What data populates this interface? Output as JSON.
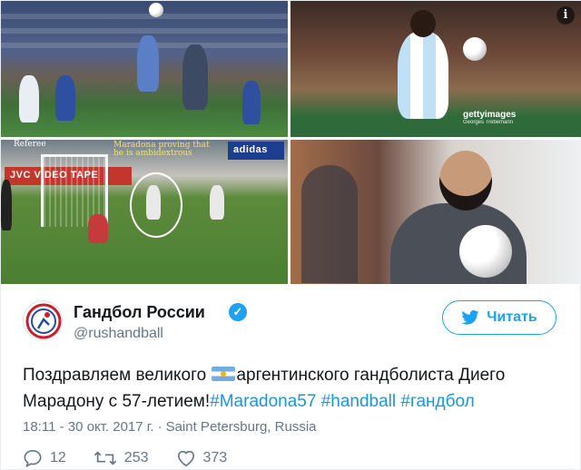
{
  "media": {
    "tile3": {
      "referee_label": "Referee",
      "annotation": "Maradona proving that he is ambidextrous",
      "ad_boards": [
        "JVC VIDEO TAPE",
        "adidas"
      ]
    },
    "tile2": {
      "watermark_brand": "gettyimages",
      "watermark_credit": "Georges Trebemann"
    }
  },
  "tweet": {
    "author_name": "Гандбол России",
    "author_handle": "@rushandball",
    "follow_label": "Читать",
    "text_part1": "Поздравляем великого ",
    "text_part2": "аргентинского гандболиста Диего Марадону с 57-летием!",
    "hashtags": [
      "#Maradona57",
      "#handball",
      "#гандбол"
    ],
    "time": "18:11 - 30 окт. 2017 г.",
    "location": "Saint Petersburg, Russia",
    "reply_count": "12",
    "retweet_count": "253",
    "like_count": "373"
  },
  "colors": {
    "accent": "#1da1f2",
    "hashtag": "#1b95e0",
    "muted": "#657786",
    "argentina_flag_blue": "#74acdf"
  },
  "icons": {
    "info": "info-icon",
    "verified": "verified-badge-icon",
    "follow": "twitter-bird-icon",
    "reply": "reply-icon",
    "retweet": "retweet-icon",
    "like": "heart-icon"
  }
}
